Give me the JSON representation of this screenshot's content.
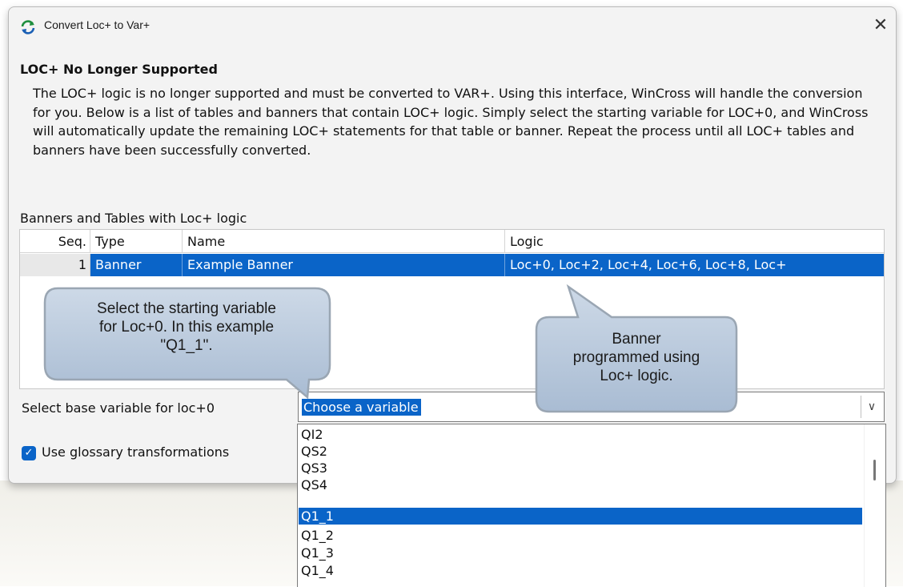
{
  "window": {
    "title": "Convert Loc+ to Var+",
    "close_glyph": "✕",
    "icon": "refresh-icon"
  },
  "heading": "LOC+ No Longer Supported",
  "description": "The LOC+ logic is no longer supported and must be converted to VAR+. Using this interface, WinCross will handle the conversion for you. Below is a list of tables and banners that contain LOC+ logic. Simply select the starting variable for LOC+0, and WinCross will automatically update the remaining LOC+ statements for that table or banner. Repeat the process until all LOC+ tables and banners have been successfully converted.",
  "section_label": "Banners and Tables with Loc+ logic",
  "grid": {
    "columns": [
      "Seq.",
      "Type",
      "Name",
      "Logic"
    ],
    "rows": [
      {
        "seq": "1",
        "type": "Banner",
        "name": "Example Banner",
        "logic": "Loc+0, Loc+2, Loc+4, Loc+6, Loc+8, Loc+"
      }
    ]
  },
  "base_variable": {
    "label": "Select base variable for loc+0",
    "value": "Choose a variable",
    "arrow_glyph": "∨"
  },
  "glossary": {
    "label": "Use glossary transformations",
    "checked": true,
    "check_glyph": "✓"
  },
  "dropdown": {
    "items": [
      "QI2",
      "QS2",
      "QS3",
      "QS4",
      "Q1_1",
      "Q1_2",
      "Q1_3",
      "Q1_4"
    ],
    "selected": "Q1_1"
  },
  "callouts": {
    "left": [
      "Select the starting variable",
      "for Loc+0. In this example",
      "\"Q1_1\"."
    ],
    "right": [
      "Banner",
      "programmed using",
      "Loc+ logic."
    ]
  },
  "colors": {
    "selection": "#0a64c8",
    "callout_fill": "#b9cbe0",
    "callout_border": "#9aa6b3"
  }
}
